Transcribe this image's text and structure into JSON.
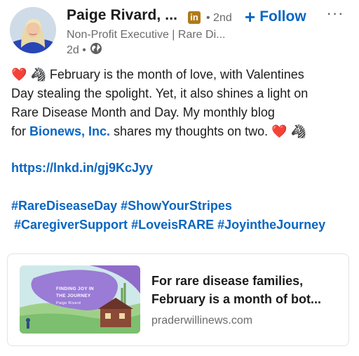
{
  "author": {
    "name": "Paige Rivard, ...",
    "badge": "in",
    "degree": "• 2nd",
    "headline": "Non-Profit Executive | Rare Di...",
    "time": "2d •"
  },
  "actions": {
    "follow_icon": "+",
    "follow_label": "Follow",
    "more_icon": "···"
  },
  "body": {
    "line1_text": "February is the month of love, with Valentines",
    "line2": "Day stealing the spolight. Yet, it also shines a light on",
    "line3": "Rare Disease Month and Day. My monthly blog",
    "line4_pre": "for ",
    "line4_mention": "Bionews, Inc.",
    "line4_post": " shares my thoughts on two.",
    "link": "https://lnkd.in/gj9KcJyy",
    "hashtags_row1": [
      "#RareDiseaseDay",
      "#ShowYourStripes"
    ],
    "hashtags_row2": [
      "#CaregiverSupport",
      "#LoveisRARE",
      "#JoyintheJourney"
    ]
  },
  "emoji": {
    "heart": "❤️",
    "zebra": "🦓"
  },
  "card": {
    "title_line1": "For rare disease families,",
    "title_line2": "February is a month of bot...",
    "domain": "praderwillinews.com",
    "thumb_title_line1": "FINDING JOY IN",
    "thumb_title_line2": "THE JOURNEY",
    "thumb_byline": "Paige Rivard"
  },
  "colors": {
    "link_blue": "#0a66c2",
    "muted_text": "#6b6b6b",
    "badge_gold": "#b07a1a"
  }
}
